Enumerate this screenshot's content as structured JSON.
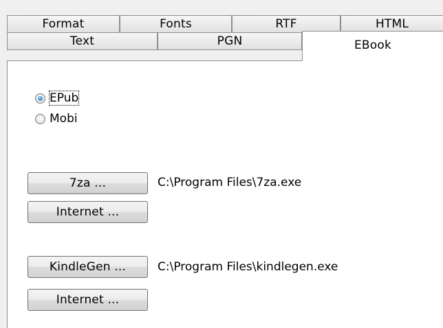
{
  "tabs": {
    "row_back": [
      "Format",
      "Fonts",
      "RTF",
      "HTML"
    ],
    "row_front": [
      "Text",
      "PGN",
      "EBook"
    ],
    "selected": "EBook"
  },
  "format_options": {
    "selected": "EPub",
    "items": [
      "EPub",
      "Mobi"
    ]
  },
  "tools": [
    {
      "button_label": "7za ...",
      "path": "C:\\Program Files\\7za.exe",
      "internet_label": "Internet ..."
    },
    {
      "button_label": "KindleGen ...",
      "path": "C:\\Program Files\\kindlegen.exe",
      "internet_label": "Internet ..."
    }
  ],
  "colors": {
    "window_bg": "#f0f0f0",
    "panel_bg": "#ffffff",
    "border": "#8e8e8e",
    "radio_accent": "#1a5fb4"
  }
}
